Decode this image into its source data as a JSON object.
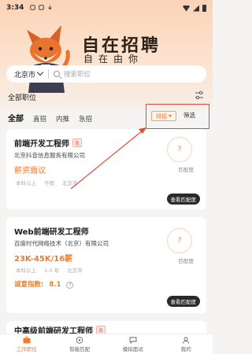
{
  "status_bar": {
    "time": "3:34"
  },
  "banner": {
    "title": "自在招聘",
    "subtitle": "自在由你"
  },
  "search": {
    "city": "北京市",
    "placeholder": "搜索职位"
  },
  "section": {
    "title": "全部职位"
  },
  "tabs": [
    {
      "label": "全部",
      "active": true
    },
    {
      "label": "直招"
    },
    {
      "label": "内推"
    },
    {
      "label": "急招"
    }
  ],
  "sort": {
    "label": "排招"
  },
  "filter": {
    "label": "筛选"
  },
  "jobs": [
    {
      "title": "前端开发工程师",
      "badge": "急",
      "company": "北京抖音信息服务有限公司",
      "salary": "薪资面议",
      "chips": [
        "本科以上",
        "不限",
        "北京市"
      ],
      "match_value": "?",
      "match_label": "匹配度",
      "view_button": "查看匹配度"
    },
    {
      "title": "Web前端研发工程师",
      "company": "百度时代网络技术（北京）有限公司",
      "salary": "23K-45K/16薪",
      "chips": [
        "本科以上",
        "3-5 年",
        "北京市"
      ],
      "honesty_label": "诚意指数:",
      "honesty_value": "8.1",
      "honesty_help": "?",
      "match_value": "?",
      "match_label": "匹配度",
      "view_button": "查看匹配度"
    },
    {
      "title": "中高级前端研发工程师",
      "badge": "急"
    }
  ],
  "bottom_nav": [
    {
      "label": "工作职位",
      "active": true
    },
    {
      "label": "智能匹配"
    },
    {
      "label": "模拟面试"
    },
    {
      "label": "我的"
    }
  ],
  "colors": {
    "accent": "#ee7b2f",
    "highlight": "#e24a3b",
    "badge": "#e25a4a"
  }
}
